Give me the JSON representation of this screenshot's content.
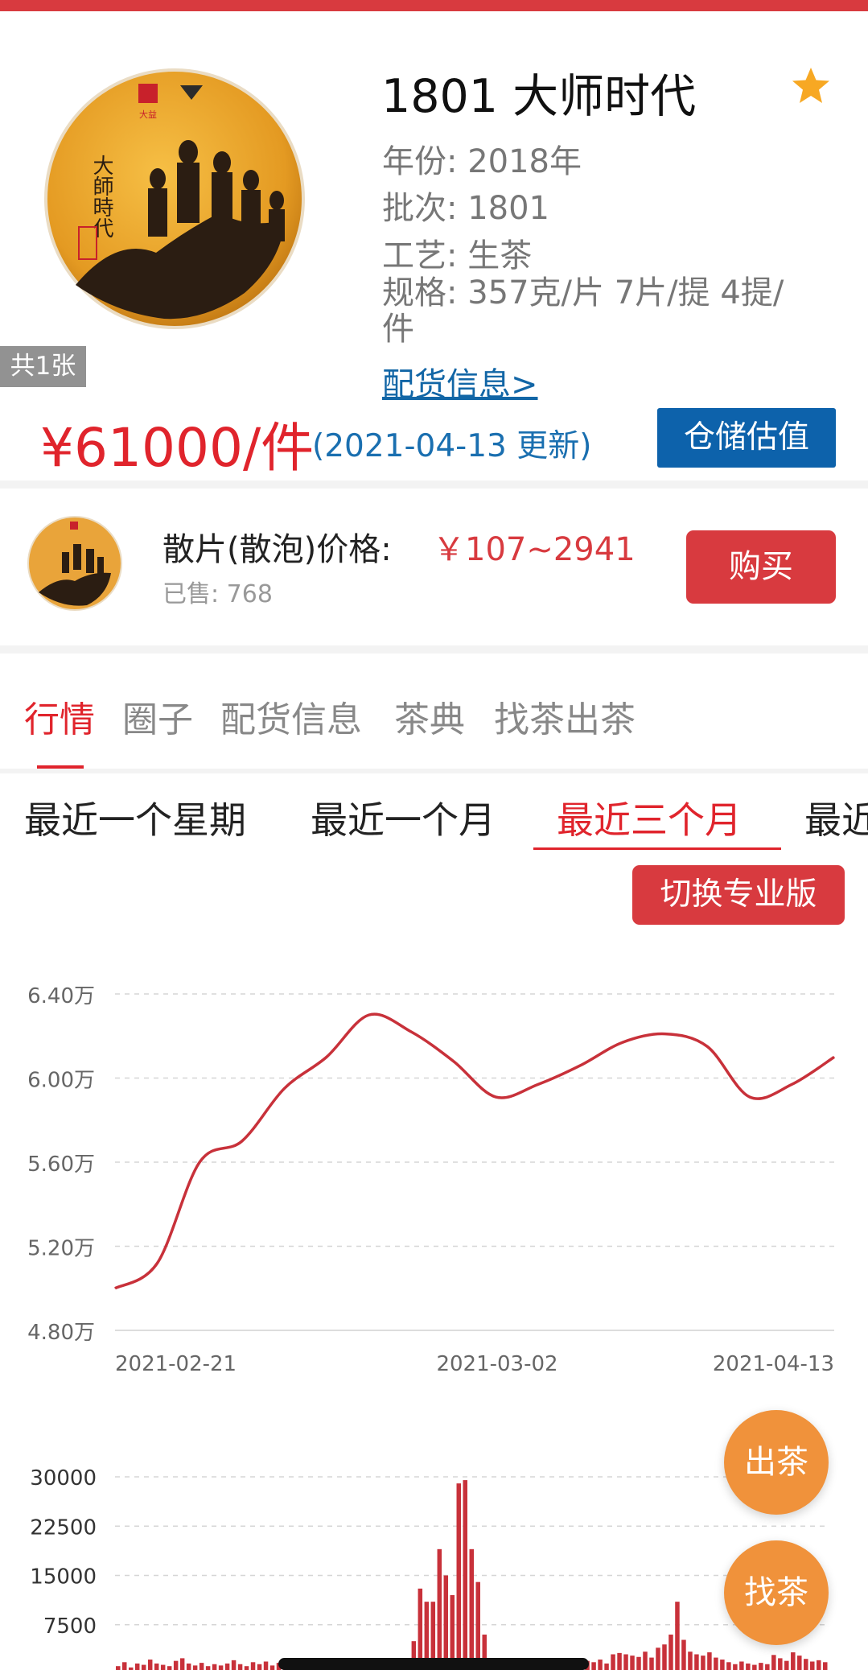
{
  "product": {
    "title": "1801 大师时代",
    "year": "年份: 2018年",
    "batch": "批次: 1801",
    "craft": "工艺: 生茶",
    "spec_line1": "规格: 357克/片 7片/提 4提/",
    "spec_line2": "件",
    "distribution_link": "配货信息>",
    "image_count": "共1张",
    "cake_text_name": "大師時代",
    "cake_brand": "大益",
    "price": "¥61000/件",
    "price_update": "(2021-04-13 更新)",
    "storage_button": "仓储估值",
    "favorite_icon": "star-icon"
  },
  "loose": {
    "label": "散片(散泡)价格:",
    "price": "￥107~2941",
    "sold": "已售: 768",
    "buy_button": "购买"
  },
  "tabs": [
    {
      "label": "行情",
      "active": true
    },
    {
      "label": "圈子",
      "active": false
    },
    {
      "label": "配货信息",
      "active": false
    },
    {
      "label": "茶典",
      "active": false
    },
    {
      "label": "找茶出茶",
      "active": false
    }
  ],
  "periods": [
    {
      "label": "最近一个星期",
      "active": false
    },
    {
      "label": "最近一个月",
      "active": false
    },
    {
      "label": "最近三个月",
      "active": true
    },
    {
      "label": "最近",
      "active": false
    }
  ],
  "pro_button": "切换专业版",
  "fab": {
    "sell": "出茶",
    "find": "找茶"
  },
  "colors": {
    "accent_red": "#d83a3f",
    "price_red": "#e0242c",
    "blue": "#0d62ab",
    "orange": "#f0923b"
  },
  "chart_data": [
    {
      "type": "line",
      "yticks": [
        "6.40万",
        "6.00万",
        "5.60万",
        "5.20万",
        "4.80万"
      ],
      "ylim": [
        48000,
        64000
      ],
      "xticks": [
        "2021-02-21",
        "2021-03-02",
        "2021-04-13"
      ],
      "x": [
        "2021-02-21",
        "2021-02-24",
        "2021-02-27",
        "2021-03-02",
        "2021-03-05",
        "2021-03-08",
        "2021-03-11",
        "2021-03-14",
        "2021-03-17",
        "2021-03-20",
        "2021-03-23",
        "2021-03-26",
        "2021-03-29",
        "2021-04-01",
        "2021-04-04",
        "2021-04-07",
        "2021-04-10",
        "2021-04-13"
      ],
      "values": [
        50000,
        51200,
        56000,
        57000,
        59500,
        61000,
        63000,
        62200,
        60800,
        59100,
        59700,
        60600,
        61700,
        62100,
        61500,
        59100,
        59700,
        61000
      ],
      "color": "#c8313a",
      "grid": true
    },
    {
      "type": "bar",
      "yticks": [
        "30000",
        "22500",
        "15000",
        "7500"
      ],
      "ylim": [
        0,
        30000
      ],
      "values": [
        1200,
        1800,
        1000,
        1600,
        1400,
        2200,
        1600,
        1400,
        1200,
        2000,
        2400,
        1600,
        1300,
        1700,
        1200,
        1500,
        1300,
        1600,
        2100,
        1500,
        1200,
        1800,
        1500,
        1900,
        1300,
        1700,
        2000,
        1500,
        1300,
        1800,
        1400,
        1700,
        1500,
        1900,
        2300,
        1700,
        1500,
        1200,
        1900,
        1600,
        1300,
        1700,
        1400,
        2000,
        1600,
        1300,
        5000,
        13000,
        11000,
        11000,
        19000,
        15000,
        12000,
        29000,
        29500,
        19000,
        14000,
        6000,
        2200,
        1800,
        1600,
        1400,
        1800,
        1500,
        1300,
        2100,
        1700,
        1600,
        1400,
        1900,
        1700,
        1500,
        1300,
        2000,
        1800,
        2200,
        1600,
        3000,
        3200,
        3000,
        2800,
        2600,
        3400,
        2500,
        4000,
        4500,
        6000,
        11000,
        5200,
        3400,
        3000,
        2800,
        3300,
        2500,
        2200,
        1800,
        1500,
        1900,
        1600,
        1400,
        1700,
        1500,
        2900,
        2400,
        2000,
        3300,
        2800,
        2300,
        1900,
        2100,
        1800
      ],
      "color": "#c8313a",
      "grid": true
    }
  ]
}
